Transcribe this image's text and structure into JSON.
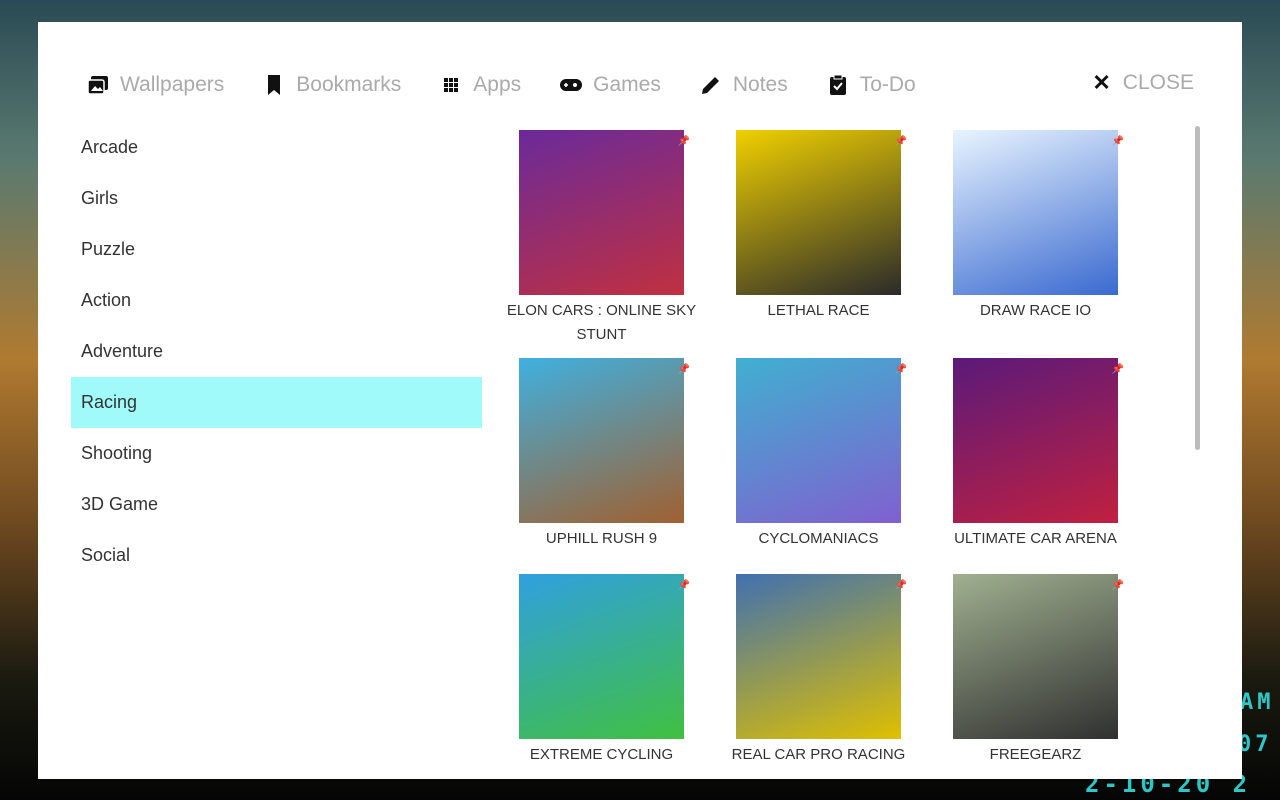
{
  "nav": {
    "items": [
      {
        "label": "Wallpapers",
        "icon": "wallpapers-icon"
      },
      {
        "label": "Bookmarks",
        "icon": "bookmark-icon"
      },
      {
        "label": "Apps",
        "icon": "apps-grid-icon"
      },
      {
        "label": "Games",
        "icon": "gamepad-icon"
      },
      {
        "label": "Notes",
        "icon": "pencil-icon"
      },
      {
        "label": "To-Do",
        "icon": "clipboard-check-icon"
      }
    ],
    "close": "CLOSE"
  },
  "categories": [
    "Arcade",
    "Girls",
    "Puzzle",
    "Action",
    "Adventure",
    "Racing",
    "Shooting",
    "3D Game",
    "Social"
  ],
  "active_category": "Racing",
  "games": [
    {
      "title": "ELON CARS : ONLINE SKY STUNT",
      "colors": [
        "#6a2a9a",
        "#c03040"
      ]
    },
    {
      "title": "LETHAL RACE",
      "colors": [
        "#f0d000",
        "#2a2a2a"
      ]
    },
    {
      "title": "DRAW RACE IO",
      "colors": [
        "#e8f4ff",
        "#3a6ad0"
      ]
    },
    {
      "title": "UPHILL RUSH 9",
      "colors": [
        "#40b0e0",
        "#a06030"
      ]
    },
    {
      "title": "CYCLOMANIACS",
      "colors": [
        "#40b0d0",
        "#8060d0"
      ]
    },
    {
      "title": "ULTIMATE CAR ARENA",
      "colors": [
        "#5a1a7a",
        "#c02040"
      ]
    },
    {
      "title": "EXTREME CYCLING",
      "colors": [
        "#30a0e0",
        "#40c040"
      ]
    },
    {
      "title": "REAL CAR PRO RACING",
      "colors": [
        "#4070b0",
        "#e0c000"
      ]
    },
    {
      "title": "FREEGEARZ",
      "colors": [
        "#a0b090",
        "#303030"
      ]
    }
  ],
  "clock": {
    "ampm": "AM",
    "time_fragment": "07",
    "date_fragment": "2-10-20 2"
  }
}
